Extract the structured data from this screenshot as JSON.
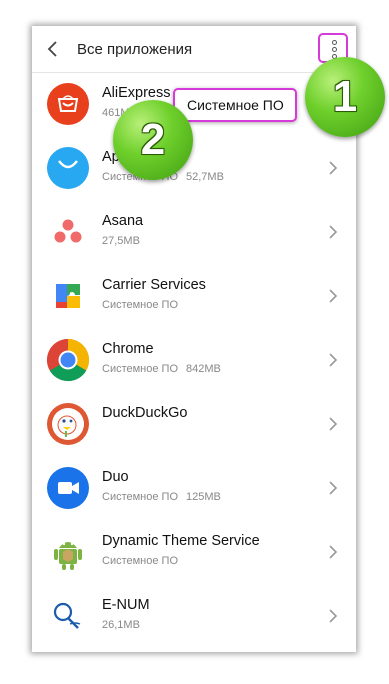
{
  "header": {
    "title": "Все приложения"
  },
  "apps": [
    {
      "name": "AliExpress",
      "meta": [
        "461M",
        ""
      ],
      "icon": "aliexpress-icon"
    },
    {
      "name": "App",
      "meta": [
        "Системное ПО",
        "52,7MB"
      ],
      "icon": "appgallery-icon"
    },
    {
      "name": "Asana",
      "meta": [
        "27,5MB",
        ""
      ],
      "icon": "asana-icon"
    },
    {
      "name": "Carrier Services",
      "meta": [
        "Системное ПО",
        ""
      ],
      "icon": "carrier-services-icon"
    },
    {
      "name": "Chrome",
      "meta": [
        "Системное ПО",
        "842MB"
      ],
      "icon": "chrome-icon"
    },
    {
      "name": "DuckDuckGo",
      "meta": [
        "",
        ""
      ],
      "icon": "duckduckgo-icon"
    },
    {
      "name": "Duo",
      "meta": [
        "Системное ПО",
        "125MB"
      ],
      "icon": "duo-icon"
    },
    {
      "name": "Dynamic Theme Service",
      "meta": [
        "Системное ПО",
        ""
      ],
      "icon": "dynamic-theme-icon"
    },
    {
      "name": "E-NUM",
      "meta": [
        "26,1MB",
        ""
      ],
      "icon": "enum-icon"
    }
  ],
  "popup": {
    "label": "Системное ПО"
  },
  "badges": {
    "one": "1",
    "two": "2"
  },
  "colors": {
    "highlight": "#d63ad8",
    "badge": "#6fd02c"
  }
}
